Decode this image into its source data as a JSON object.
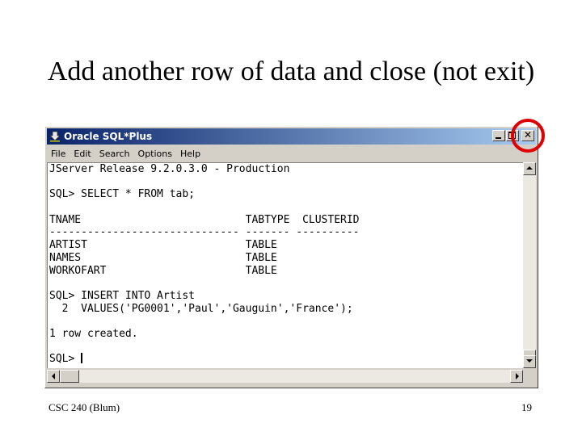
{
  "slide": {
    "title": "Add another row of data and close (not exit)",
    "footer_left": "CSC 240 (Blum)",
    "page_number": "19"
  },
  "window": {
    "title": "Oracle SQL*Plus",
    "app_icon": "download-arrow-icon",
    "controls": {
      "minimize_icon": "minimize-icon",
      "maximize_icon": "maximize-icon",
      "close_icon": "close-icon",
      "close_glyph": "✕"
    }
  },
  "menu": {
    "items": [
      {
        "label": "File"
      },
      {
        "label": "Edit"
      },
      {
        "label": "Search"
      },
      {
        "label": "Options"
      },
      {
        "label": "Help"
      }
    ]
  },
  "console": {
    "lines": [
      "JServer Release 9.2.0.3.0 - Production",
      "",
      "SQL> SELECT * FROM tab;",
      "",
      "TNAME                          TABTYPE  CLUSTERID",
      "------------------------------ ------- ----------",
      "ARTIST                         TABLE",
      "NAMES                          TABLE",
      "WORKOFART                      TABLE",
      "",
      "SQL> INSERT INTO Artist",
      "  2  VALUES('PG0001','Paul','Gauguin','France');",
      "",
      "1 row created.",
      "",
      "SQL> "
    ]
  },
  "annotation": {
    "highlight_color": "#e00000"
  },
  "colors": {
    "titlebar_start": "#0a246a",
    "titlebar_end": "#a6caf0",
    "window_face": "#d4d0c8"
  }
}
